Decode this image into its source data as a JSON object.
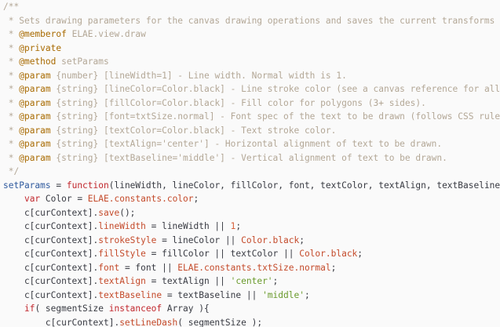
{
  "theme": {
    "background": "#fafafa",
    "comment": "#b3a796",
    "keyword": "#c1272d",
    "doc_tag": "#a86a00",
    "number": "#d6603a",
    "string": "#6a9a2c",
    "property": "#c44a2a",
    "function_name": "#2f5a9e",
    "text": "#383a42"
  },
  "lines": [
    [
      [
        "c",
        "/**"
      ]
    ],
    [
      [
        "c",
        " * Sets drawing parameters for the canvas drawing operations and saves the current transforms stack"
      ]
    ],
    [
      [
        "c",
        " * "
      ],
      [
        "tag",
        "@memberof"
      ],
      [
        "c",
        " ELAE.view.draw"
      ]
    ],
    [
      [
        "c",
        " * "
      ],
      [
        "tag",
        "@private"
      ]
    ],
    [
      [
        "c",
        " * "
      ],
      [
        "tag",
        "@method"
      ],
      [
        "c",
        " setParams"
      ]
    ],
    [
      [
        "c",
        " * "
      ],
      [
        "tag",
        "@param"
      ],
      [
        "c",
        " {number} [lineWidth=1] - Line width. Normal width is 1."
      ]
    ],
    [
      [
        "c",
        " * "
      ],
      [
        "tag",
        "@param"
      ],
      [
        "c",
        " {string} [lineColor=Color.black] - Line stroke color (see a canvas reference for allowed values)."
      ]
    ],
    [
      [
        "c",
        " * "
      ],
      [
        "tag",
        "@param"
      ],
      [
        "c",
        " {string} [fillColor=Color.black] - Fill color for polygons (3+ sides)."
      ]
    ],
    [
      [
        "c",
        " * "
      ],
      [
        "tag",
        "@param"
      ],
      [
        "c",
        " {string} [font=txtSize.normal] - Font spec of the text to be drawn (follows CSS rules)."
      ]
    ],
    [
      [
        "c",
        " * "
      ],
      [
        "tag",
        "@param"
      ],
      [
        "c",
        " {string} [textColor=Color.black] - Text stroke color."
      ]
    ],
    [
      [
        "c",
        " * "
      ],
      [
        "tag",
        "@param"
      ],
      [
        "c",
        " {string} [textAlign='center'] - Horizontal alignment of text to be drawn."
      ]
    ],
    [
      [
        "c",
        " * "
      ],
      [
        "tag",
        "@param"
      ],
      [
        "c",
        " {string} [textBaseline='middle'] - Vertical alignment of text to be drawn."
      ]
    ],
    [
      [
        "c",
        " */"
      ]
    ],
    [
      [
        "fn",
        "setParams"
      ],
      [
        "id",
        " = "
      ],
      [
        "kw",
        "function"
      ],
      [
        "id",
        "(lineWidth, lineColor, fillColor, font, textColor, textAlign, textBaseline, segmentSize){"
      ]
    ],
    [
      [
        "id",
        "    "
      ],
      [
        "kw",
        "var"
      ],
      [
        "id",
        " Color = "
      ],
      [
        "prop",
        "ELAE.constants.color"
      ],
      [
        "id",
        ";"
      ]
    ],
    [
      [
        "id",
        "    c[curContext]."
      ],
      [
        "prop",
        "save"
      ],
      [
        "id",
        "();"
      ]
    ],
    [
      [
        "id",
        "    c[curContext]."
      ],
      [
        "prop",
        "lineWidth"
      ],
      [
        "id",
        " = lineWidth || "
      ],
      [
        "num",
        "1"
      ],
      [
        "id",
        ";"
      ]
    ],
    [
      [
        "id",
        "    c[curContext]."
      ],
      [
        "prop",
        "strokeStyle"
      ],
      [
        "id",
        " = lineColor || "
      ],
      [
        "prop",
        "Color.black"
      ],
      [
        "id",
        ";"
      ]
    ],
    [
      [
        "id",
        "    c[curContext]."
      ],
      [
        "prop",
        "fillStyle"
      ],
      [
        "id",
        " = fillColor || textColor || "
      ],
      [
        "prop",
        "Color.black"
      ],
      [
        "id",
        ";"
      ]
    ],
    [
      [
        "id",
        "    c[curContext]."
      ],
      [
        "prop",
        "font"
      ],
      [
        "id",
        " = font || "
      ],
      [
        "prop",
        "ELAE.constants.txtSize.normal"
      ],
      [
        "id",
        ";"
      ]
    ],
    [
      [
        "id",
        "    c[curContext]."
      ],
      [
        "prop",
        "textAlign"
      ],
      [
        "id",
        " = textAlign || "
      ],
      [
        "str",
        "'center'"
      ],
      [
        "id",
        ";"
      ]
    ],
    [
      [
        "id",
        "    c[curContext]."
      ],
      [
        "prop",
        "textBaseline"
      ],
      [
        "id",
        " = textBaseline || "
      ],
      [
        "str",
        "'middle'"
      ],
      [
        "id",
        ";"
      ]
    ],
    [
      [
        "id",
        "    "
      ],
      [
        "kw",
        "if"
      ],
      [
        "id",
        "( segmentSize "
      ],
      [
        "kw",
        "instanceof"
      ],
      [
        "id",
        " Array ){"
      ]
    ],
    [
      [
        "id",
        "        c[curContext]."
      ],
      [
        "prop",
        "setLineDash"
      ],
      [
        "id",
        "( segmentSize );"
      ]
    ]
  ]
}
